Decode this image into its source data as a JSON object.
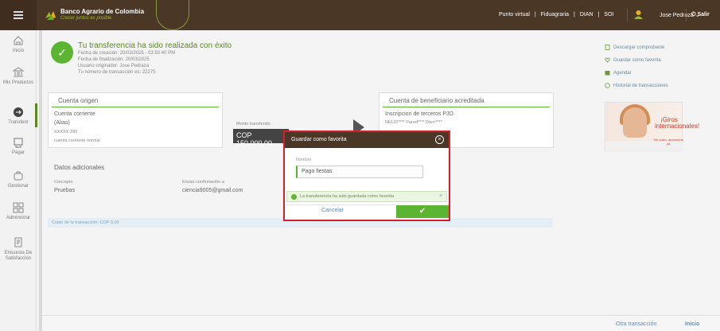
{
  "header": {
    "brand_title": "Banco Agrario de Colombia",
    "brand_subtitle": "Crecer juntos es posible",
    "nav_links": [
      "Punto virtual",
      "|",
      "Fiduagraria",
      "|",
      "DIAN",
      "|",
      "SOI"
    ],
    "user_name": "Jose Pedraza",
    "user_chevron": "⌄",
    "exit_label": "Salir"
  },
  "sidebar": {
    "items": [
      {
        "label": "Inicio",
        "icon": "home-icon"
      },
      {
        "label": "Mis Productos",
        "icon": "bank-icon"
      },
      {
        "label": "Transferir",
        "icon": "transfer-icon"
      },
      {
        "label": "Pagar",
        "icon": "pay-icon"
      },
      {
        "label": "Gestionar",
        "icon": "manage-icon"
      },
      {
        "label": "Administrar",
        "icon": "admin-icon"
      },
      {
        "label": "Encuesta De Satisfacción",
        "icon": "survey-icon"
      }
    ]
  },
  "success": {
    "title": "Tu transferencia ha sido realizada con éxito",
    "created": "Fecha de creación: 20/03/2025 - 03:50:40 PM",
    "finished": "Fecha de finalización: 20/03/2025",
    "originator": "Usuario originador: Jose Pedraza",
    "transaction_number": "Tu número de transacción es: 22275"
  },
  "origin": {
    "title": "Cuenta origen",
    "account_type": "Cuenta corriente",
    "alias": "(Alias)",
    "masked": "XXXXX-395",
    "desc": "cuenta corriente normal"
  },
  "transfer": {
    "amount_label": "Monto transferido",
    "amount": "COP 150.000,00"
  },
  "beneficiary": {
    "title": "Cuenta de beneficiario acreditada",
    "line1": "Inscripcion de terceros PJO",
    "line2": "NELID**** Pared**** Dterr****"
  },
  "additional": {
    "title": "Datos adicionales",
    "concept_label": "Concepto",
    "concept_value": "Pruebas",
    "confirm_label": "Enviar confirmación a",
    "confirm_value": "ciencia9005@gmail.com"
  },
  "cost_text": "Costo de la transacción: COP 0,00",
  "right_links": [
    {
      "label": "Descargar comprobante",
      "icon": "download-icon"
    },
    {
      "label": "Guardar como favorita",
      "icon": "heart-icon"
    },
    {
      "label": "Agendar",
      "icon": "calendar-icon"
    },
    {
      "label": "Historial de transacciones",
      "icon": "history-icon"
    }
  ],
  "promo": {
    "title": "¡Giros internacionales!",
    "subtitle": "Sin costo, aprovecha ya"
  },
  "bottom": {
    "other_transaction": "Otra transacción",
    "home": "Inicio"
  },
  "modal": {
    "title": "Guardar como favorita",
    "close": "×",
    "field_label": "Nombre",
    "field_value": "Pago fiestas",
    "notice": "La transferencia ha sido guardada como favorita",
    "notice_close": "×",
    "cancel": "Cancelar",
    "ok": "✔"
  },
  "colors": {
    "header_brown": "#4a3726",
    "brand_green": "#5cb531",
    "highlight_red": "#d61f2c"
  }
}
